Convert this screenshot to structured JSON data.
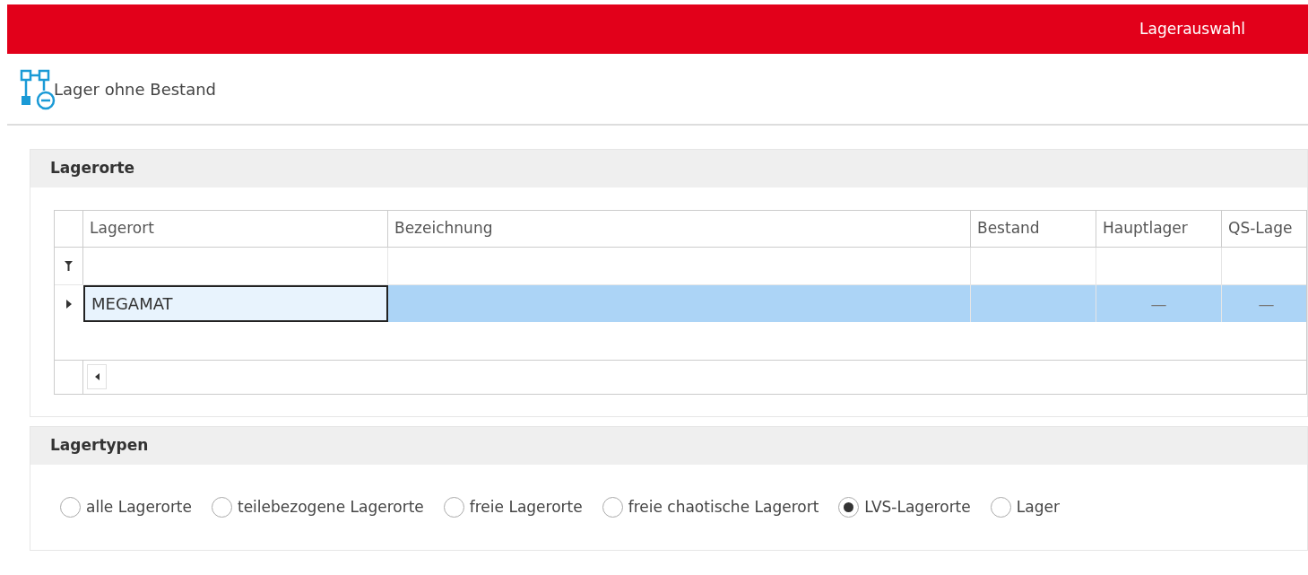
{
  "header": {
    "title": "Lagerauswahl"
  },
  "toolbar": {
    "button": {
      "label": "Lager ohne Bestand"
    }
  },
  "lagerorte": {
    "title": "Lagerorte",
    "columns": [
      "Lagerort",
      "Bezeichnung",
      "Bestand",
      "Hauptlager",
      "QS-Lage"
    ],
    "rows": [
      {
        "selected": true,
        "cells": [
          "MEGAMAT",
          "",
          "",
          "—",
          "—"
        ]
      }
    ]
  },
  "lagertypen": {
    "title": "Lagertypen",
    "options": [
      {
        "label": "alle Lagerorte",
        "selected": false
      },
      {
        "label": "teilebezogene Lagerorte",
        "selected": false
      },
      {
        "label": "freie Lagerorte",
        "selected": false
      },
      {
        "label": "freie chaotische Lagerort",
        "selected": false
      },
      {
        "label": "LVS-Lagerorte",
        "selected": true
      },
      {
        "label": "Lager",
        "selected": false
      }
    ]
  }
}
